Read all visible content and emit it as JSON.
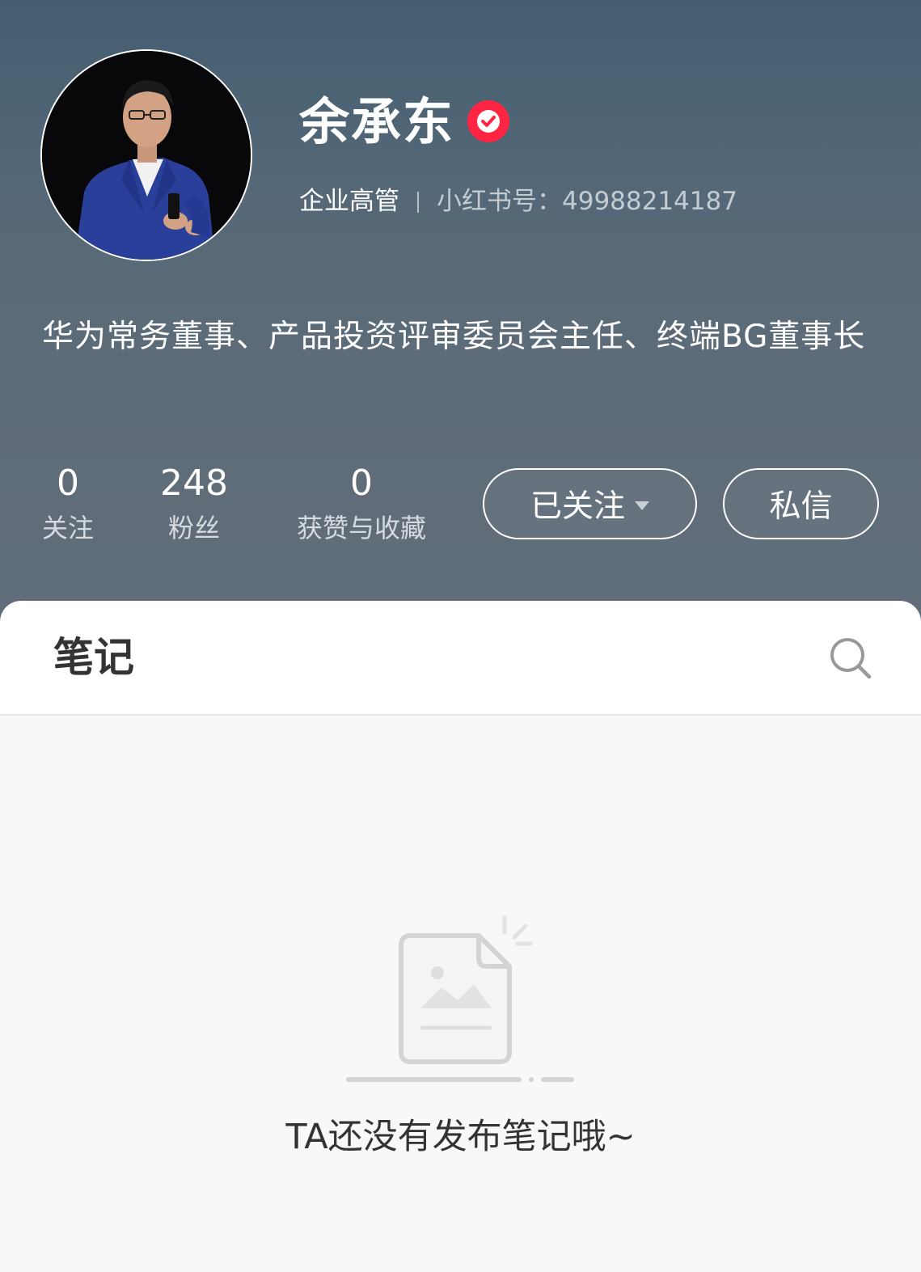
{
  "profile": {
    "name": "余承东",
    "role": "企业高管",
    "xhs_id": "小红书号：49988214187",
    "bio": "华为常务董事、产品投资评审委员会主任、终端BG董事长",
    "avatar_icon": "person-photo",
    "verified_icon": "verified-check-icon"
  },
  "stats": [
    {
      "num": "0",
      "label": "关注"
    },
    {
      "num": "248",
      "label": "粉丝"
    },
    {
      "num": "0",
      "label": "获赞与收藏"
    }
  ],
  "actions": {
    "follow_label": "已关注",
    "message_label": "私信"
  },
  "notes": {
    "title": "笔记",
    "empty_text": "TA还没有发布笔记哦~"
  },
  "colors": {
    "header_top": "#435e70",
    "header_bottom": "#616e79",
    "verified_red": "#ff2442",
    "page_bg": "#f8f8f8"
  }
}
